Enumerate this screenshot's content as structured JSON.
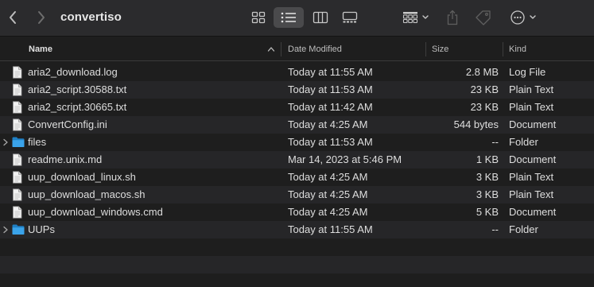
{
  "window": {
    "title": "convertiso"
  },
  "columns": {
    "name": "Name",
    "date": "Date Modified",
    "size": "Size",
    "kind": "Kind"
  },
  "files": [
    {
      "name": "aria2_download.log",
      "date": "Today at 11:55 AM",
      "size": "2.8 MB",
      "kind": "Log File",
      "type": "file"
    },
    {
      "name": "aria2_script.30588.txt",
      "date": "Today at 11:53 AM",
      "size": "23 KB",
      "kind": "Plain Text",
      "type": "file"
    },
    {
      "name": "aria2_script.30665.txt",
      "date": "Today at 11:42 AM",
      "size": "23 KB",
      "kind": "Plain Text",
      "type": "file"
    },
    {
      "name": "ConvertConfig.ini",
      "date": "Today at 4:25 AM",
      "size": "544 bytes",
      "kind": "Document",
      "type": "file"
    },
    {
      "name": "files",
      "date": "Today at 11:53 AM",
      "size": "--",
      "kind": "Folder",
      "type": "folder"
    },
    {
      "name": "readme.unix.md",
      "date": "Mar 14, 2023 at 5:46 PM",
      "size": "1 KB",
      "kind": "Document",
      "type": "file"
    },
    {
      "name": "uup_download_linux.sh",
      "date": "Today at 4:25 AM",
      "size": "3 KB",
      "kind": "Plain Text",
      "type": "file"
    },
    {
      "name": "uup_download_macos.sh",
      "date": "Today at 4:25 AM",
      "size": "3 KB",
      "kind": "Plain Text",
      "type": "file"
    },
    {
      "name": "uup_download_windows.cmd",
      "date": "Today at 4:25 AM",
      "size": "5 KB",
      "kind": "Document",
      "type": "file"
    },
    {
      "name": "UUPs",
      "date": "Today at 11:55 AM",
      "size": "--",
      "kind": "Folder",
      "type": "folder"
    }
  ],
  "colors": {
    "folder": "#3aa3ea",
    "accent": "#4a4a4c"
  }
}
